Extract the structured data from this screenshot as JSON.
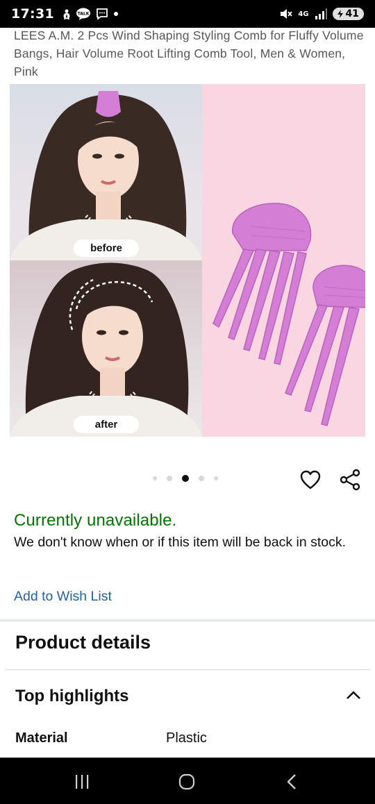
{
  "status_bar": {
    "time": "17:31",
    "network": "4G",
    "battery": "41"
  },
  "product": {
    "title": "LEES A.M. 2 Pcs Wind Shaping Styling Comb for Fluffy Volume Bangs, Hair Volume Root Lifting Comb Tool, Men & Women, Pink",
    "image": {
      "before_label": "before",
      "after_label": "after",
      "carousel_active_index": 2,
      "carousel_count": 5
    },
    "availability": "Currently unavailable.",
    "stock_message": "We don't know when or if this item will be back in stock.",
    "wishlist_link": "Add to Wish List"
  },
  "details": {
    "heading": "Product details",
    "highlights_heading": "Top highlights",
    "specs": [
      {
        "label": "Material",
        "value": "Plastic"
      }
    ]
  },
  "colors": {
    "availability_green": "#007600",
    "link_blue": "#2162a1",
    "comb_pink": "#d47ed6",
    "panel_pink": "#fad6e3"
  },
  "icons": [
    "heart-icon",
    "share-icon",
    "chevron-up-icon",
    "recents-icon",
    "home-icon",
    "back-icon"
  ]
}
